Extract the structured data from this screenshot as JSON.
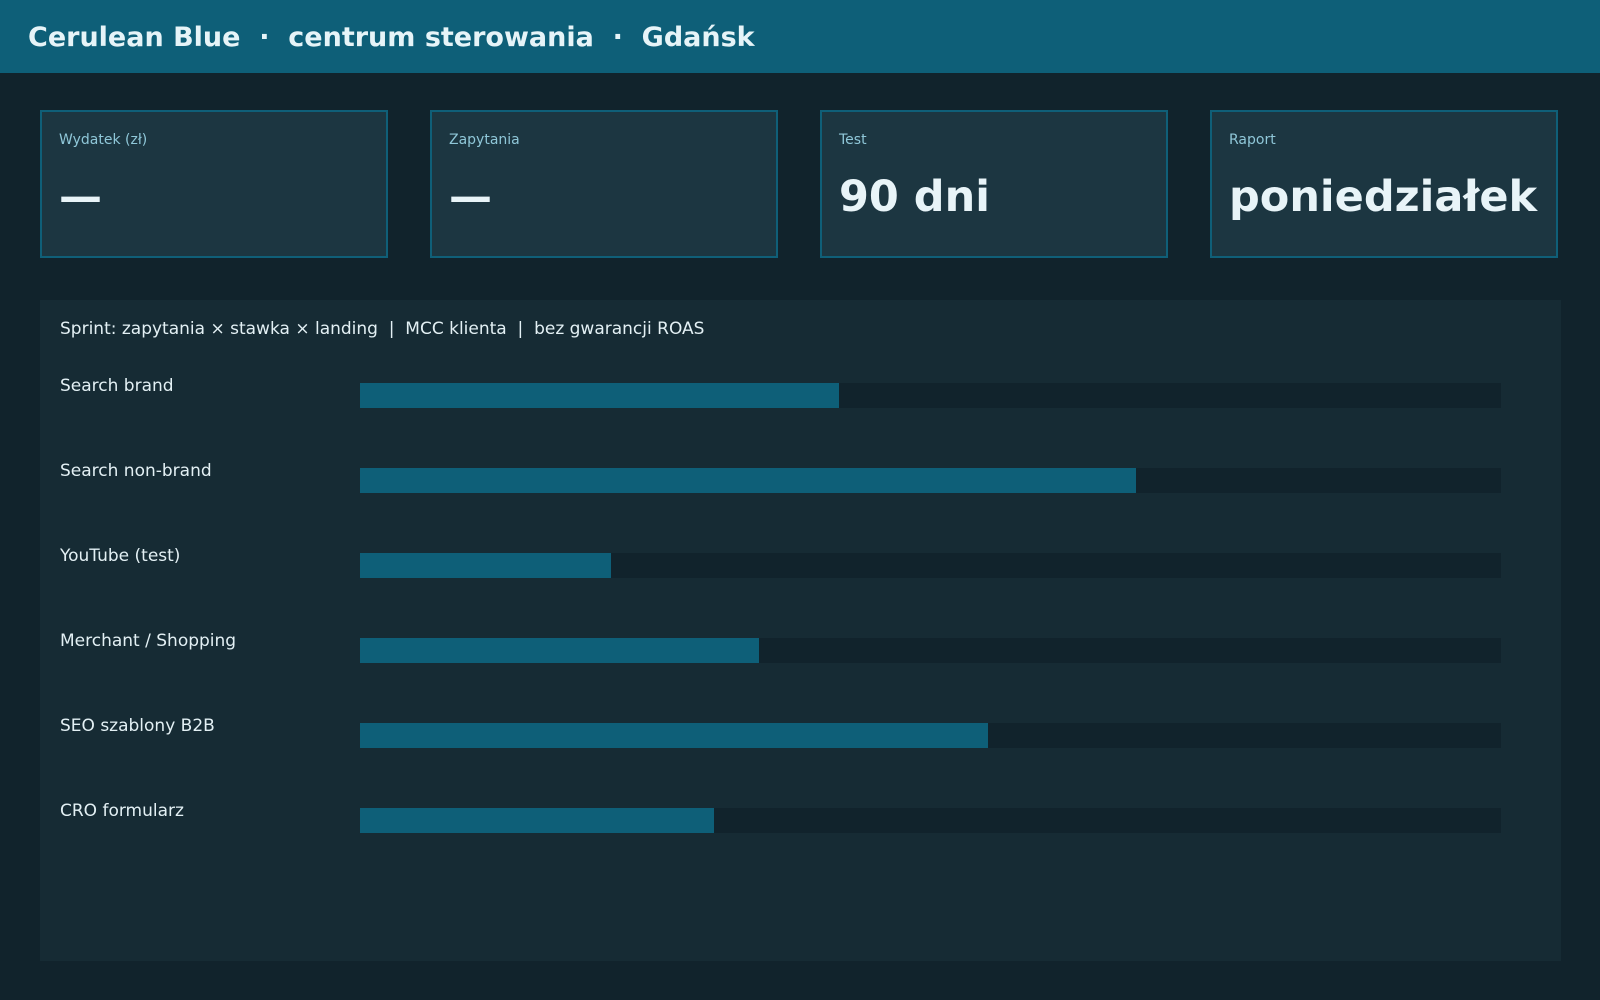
{
  "header": {
    "title": "Cerulean Blue  ·  centrum sterowania  ·  Gdańsk"
  },
  "kpis": [
    {
      "label": "Wydatek (zł)",
      "value": "—"
    },
    {
      "label": "Zapytania",
      "value": "—"
    },
    {
      "label": "Test",
      "value": "90 dni"
    },
    {
      "label": "Raport",
      "value": "poniedziałek"
    }
  ],
  "panel": {
    "caption": "Sprint: zapytania × stawka × landing  |  MCC klienta  |  bez gwarancji ROAS"
  },
  "channels": [
    {
      "label": "Search brand",
      "progress": 0.42
    },
    {
      "label": "Search non-brand",
      "progress": 0.68
    },
    {
      "label": "YouTube (test)",
      "progress": 0.22
    },
    {
      "label": "Merchant / Shopping",
      "progress": 0.35
    },
    {
      "label": "SEO szablony B2B",
      "progress": 0.55
    },
    {
      "label": "CRO formularz",
      "progress": 0.31
    }
  ],
  "colors": {
    "accent": "#0e5f78",
    "background": "#11232c",
    "card": "#1c3641",
    "panel": "#162b34"
  }
}
